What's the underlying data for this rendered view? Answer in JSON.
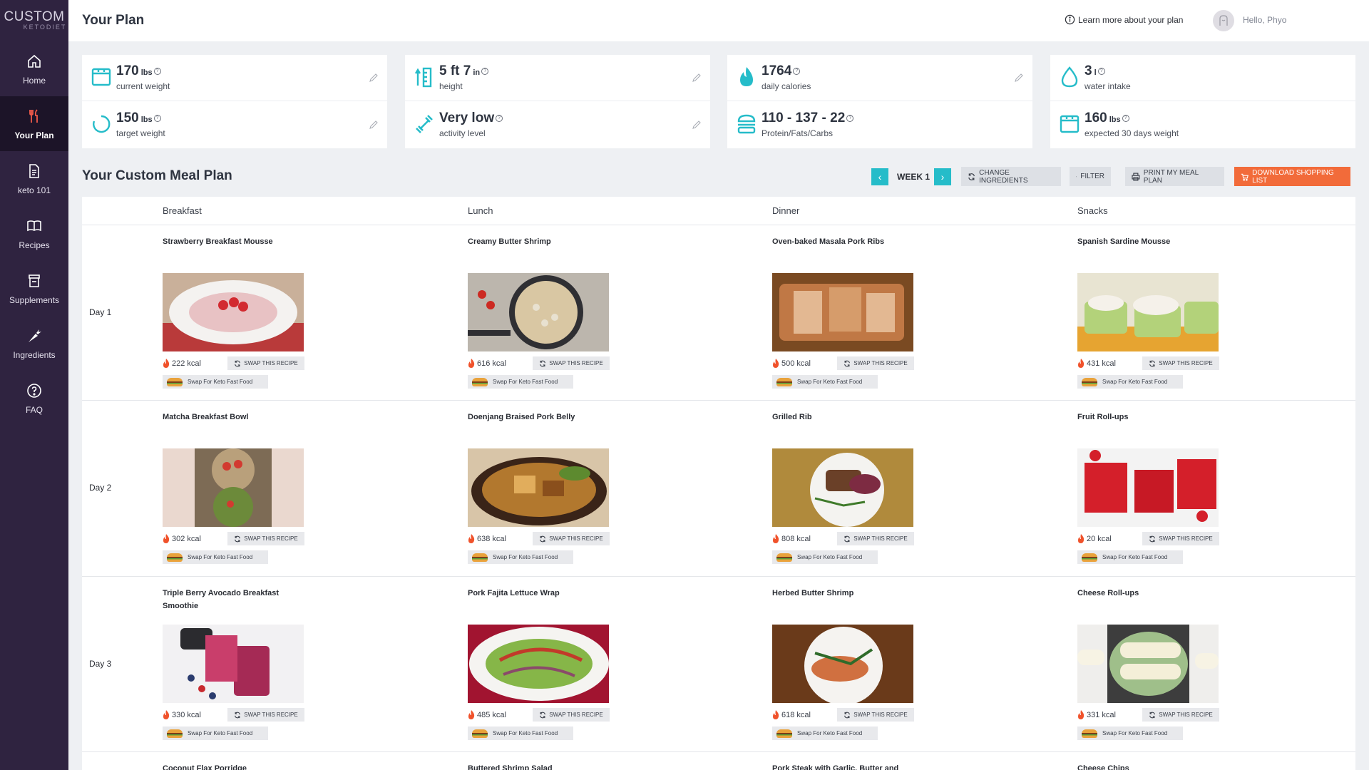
{
  "brand": {
    "line1": "CUSTOM",
    "line2": "KETODIET"
  },
  "sidebar": {
    "items": [
      {
        "label": "Home",
        "icon": "home-icon"
      },
      {
        "label": "Your Plan",
        "icon": "utensils-icon"
      },
      {
        "label": "keto 101",
        "icon": "document-icon"
      },
      {
        "label": "Recipes",
        "icon": "book-icon"
      },
      {
        "label": "Supplements",
        "icon": "jar-icon"
      },
      {
        "label": "Ingredients",
        "icon": "carrot-icon"
      },
      {
        "label": "FAQ",
        "icon": "question-icon"
      }
    ]
  },
  "header": {
    "title": "Your Plan",
    "learn_more": "Learn more about your plan",
    "greeting": "Hello, Phyo"
  },
  "stats": [
    {
      "top": {
        "value": "170",
        "unit": "lbs",
        "label": "current weight",
        "icon": "scale-icon"
      },
      "bottom": {
        "value": "150",
        "unit": "lbs",
        "label": "target weight",
        "icon": "progress-ring-icon"
      }
    },
    {
      "top": {
        "value": "5 ft 7",
        "unit": "in",
        "label": "height",
        "icon": "ruler-icon"
      },
      "bottom": {
        "value": "Very low",
        "unit": "",
        "label": "activity level",
        "icon": "dumbbell-icon"
      }
    },
    {
      "top": {
        "value": "1764",
        "unit": "",
        "label": "daily calories",
        "icon": "flame-icon"
      },
      "bottom": {
        "value": "110 - 137 - 22",
        "unit": "",
        "label": "Protein/Fats/Carbs",
        "icon": "burger-stack-icon"
      }
    },
    {
      "top": {
        "value": "3",
        "unit": "l",
        "label": "water intake",
        "icon": "water-drop-icon"
      },
      "bottom": {
        "value": "160",
        "unit": "lbs",
        "label": "expected 30 days weight",
        "icon": "scale-icon"
      }
    }
  ],
  "meal_plan": {
    "title": "Your Custom Meal Plan",
    "week_label": "WEEK 1",
    "buttons": {
      "change": "Change Ingredients",
      "filter": "Filter",
      "print": "Print My Meal Plan",
      "download": "Download Shopping List"
    },
    "columns": [
      "Breakfast",
      "Lunch",
      "Dinner",
      "Snacks"
    ],
    "swap_label": "Swap This Recipe",
    "fast_food_label": "Swap For Keto Fast Food",
    "days": [
      {
        "label": "Day 1",
        "meals": [
          {
            "name": "Strawberry Breakfast Mousse",
            "kcal": "222 kcal",
            "img": "mousse"
          },
          {
            "name": "Creamy Butter Shrimp",
            "kcal": "616 kcal",
            "img": "pan"
          },
          {
            "name": "Oven-baked Masala Pork Ribs",
            "kcal": "500 kcal",
            "img": "ribs"
          },
          {
            "name": "Spanish Sardine Mousse",
            "kcal": "431 kcal",
            "img": "cucumber"
          }
        ]
      },
      {
        "label": "Day 2",
        "meals": [
          {
            "name": "Matcha Breakfast Bowl",
            "kcal": "302 kcal",
            "img": "matcha"
          },
          {
            "name": "Doenjang Braised Pork Belly",
            "kcal": "638 kcal",
            "img": "pot"
          },
          {
            "name": "Grilled Rib",
            "kcal": "808 kcal",
            "img": "plate"
          },
          {
            "name": "Fruit Roll-ups",
            "kcal": "20 kcal",
            "img": "rollups"
          }
        ]
      },
      {
        "label": "Day 3",
        "meals": [
          {
            "name": "Triple Berry Avocado Breakfast Smoothie",
            "kcal": "330 kcal",
            "img": "smoothie"
          },
          {
            "name": "Pork Fajita Lettuce Wrap",
            "kcal": "485 kcal",
            "img": "salad"
          },
          {
            "name": "Herbed Butter Shrimp",
            "kcal": "618 kcal",
            "img": "shrimp"
          },
          {
            "name": "Cheese Roll-ups",
            "kcal": "331 kcal",
            "img": "cheese"
          }
        ]
      },
      {
        "label": "",
        "meals": [
          {
            "name": "Coconut Flax Porridge"
          },
          {
            "name": "Buttered Shrimp Salad"
          },
          {
            "name": "Pork Steak with Garlic, Butter and"
          },
          {
            "name": "Cheese Chips"
          }
        ]
      }
    ]
  },
  "colors": {
    "sidebar": "#2f2340",
    "sidebar_active": "#1c1428",
    "accent": "#25bcc9",
    "download": "#f26b3a",
    "flame": "#f0522b"
  }
}
